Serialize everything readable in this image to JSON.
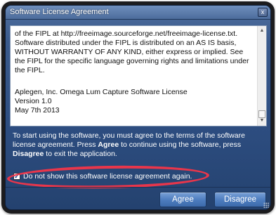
{
  "window": {
    "title": "Software License Agreement",
    "close_label": "x"
  },
  "license": {
    "paragraphs": [
      "of the FIPL at http://freeimage.sourceforge.net/freeimage-license.txt. Software distributed under the FIPL is distributed on an AS IS basis, WITHOUT WARRANTY OF ANY KIND, either express or implied. See the FIPL for the specific language governing rights and limitations under the FIPL."
    ],
    "footer_lines": [
      "Aplegen, Inc. Omega Lum Capture Software License",
      "Version 1.0",
      "May 7th 2013"
    ]
  },
  "instructions": {
    "part1": "To start using the software, you must agree to the terms of the software license agreement. Press ",
    "agree_word": "Agree",
    "part2": " to continue using the software, press ",
    "disagree_word": "Disagree",
    "part3": " to exit the application."
  },
  "checkbox": {
    "checked": true,
    "mark": "✓",
    "label": "Do not show this software license agreement again."
  },
  "buttons": {
    "agree": "Agree",
    "disagree": "Disagree"
  },
  "colors": {
    "highlight": "#e8364b",
    "window_blue": "#2d4d80"
  }
}
